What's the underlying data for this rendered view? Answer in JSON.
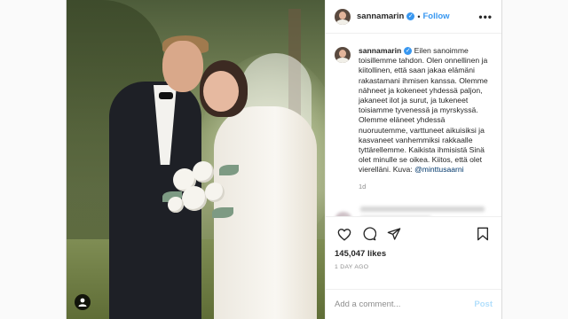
{
  "post": {
    "username": "sannamarin",
    "follow_label": "Follow",
    "dot_separator": "•",
    "more_label": "•••",
    "caption": "Eilen sanoimme toisillemme tahdon. Olen onnellinen ja kiitollinen, että saan jakaa elämäni rakastamani ihmisen kanssa. Olemme nähneet ja kokeneet yhdessä paljon, jakaneet ilot ja surut, ja tukeneet toisiamme tyvenessä ja myrskyssä. Olemme eläneet yhdessä nuoruutemme, varttuneet aikuisiksi ja kasvaneet vanhemmiksi rakkaalle tyttärellemme. Kaikista ihmisistä Sinä olet minulle se oikea. Kiitos, että olet vierelläni. Kuva: ",
    "caption_mention": "@minttusaarni",
    "time_ago": "1d",
    "likes": "145,047 likes",
    "date": "1 DAY AGO",
    "comment_placeholder": "Add a comment...",
    "post_label": "Post"
  },
  "icons": {
    "verified": "verified-badge-icon",
    "like": "heart-icon",
    "comment": "comment-icon",
    "share": "share-icon",
    "save": "bookmark-icon",
    "user_tag": "user-tag-icon"
  },
  "colors": {
    "link_blue": "#3897f0",
    "mention_blue": "#00376b",
    "muted_gray": "#8e8e8e",
    "post_disabled": "#b2dffc"
  }
}
